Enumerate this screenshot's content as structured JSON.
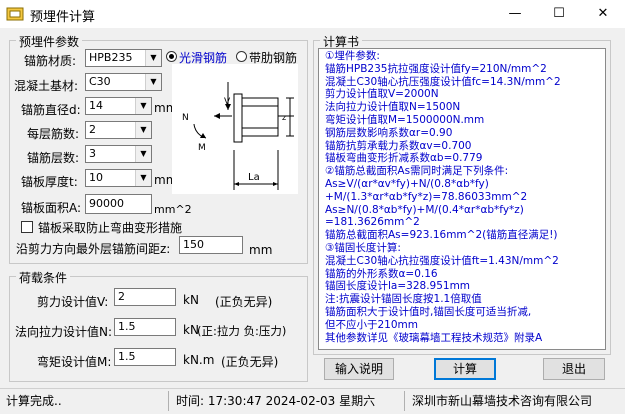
{
  "window": {
    "title": "预埋件计算",
    "minimize": "—",
    "maximize": "☐",
    "close": "✕"
  },
  "params": {
    "group_title": "预埋件参数",
    "rebar_material": {
      "label": "锚筋材质:",
      "value": "HPB235"
    },
    "concrete": {
      "label": "混凝土基材:",
      "value": "C30"
    },
    "rebar_diameter": {
      "label": "锚筋直径d:",
      "value": "14",
      "unit": "mm"
    },
    "bars_per_layer": {
      "label": "每层筋数:",
      "value": "2"
    },
    "layers": {
      "label": "锚筋层数:",
      "value": "3"
    },
    "plate_thickness": {
      "label": "锚板厚度t:",
      "value": "10",
      "unit": "mm"
    },
    "plate_area": {
      "label": "锚板面积A:",
      "value": "90000",
      "unit": "mm^2"
    },
    "radio_smooth": "光滑钢筋",
    "radio_ribbed": "带肋钢筋",
    "checkbox_bending": "锚板采取防止弯曲变形措施",
    "max_spacing": {
      "label": "沿剪力方向最外层锚筋间距z:",
      "value": "150",
      "unit": "mm"
    },
    "diagram": {
      "V": "V",
      "N": "N",
      "M": "M",
      "z": "z",
      "La": "La"
    }
  },
  "loads": {
    "group_title": "荷载条件",
    "shear": {
      "label": "剪力设计值V:",
      "value": "2",
      "unit": "kN",
      "note": "(正负无异)"
    },
    "tension": {
      "label": "法向拉力设计值N:",
      "value": "1.5",
      "unit": "kN",
      "note": "(正:拉力 负:压力)"
    },
    "moment": {
      "label": "弯矩设计值M:",
      "value": "1.5",
      "unit": "kN.m",
      "note": "(正负无异)"
    }
  },
  "report": {
    "group_title": "计算书",
    "lines": [
      "①埋件参数:",
      "  锚筋HPB235抗拉强度设计值fy=210N/mm^2",
      "  混凝土C30轴心抗压强度设计值fc=14.3N/mm^2",
      "  剪力设计值取V=2000N",
      "  法向拉力设计值取N=1500N",
      "  弯矩设计值取M=1500000N.mm",
      "  钢筋层数影响系数αr=0.90",
      "  锚筋抗剪承载力系数αv=0.700",
      "  锚板弯曲变形折减系数αb=0.779",
      "②锚筋总截面积As需同时满足下列条件:",
      "  As≥V/(αr*αv*fy)+N/(0.8*αb*fy)",
      "     +M/(1.3*αr*αb*fy*z)=78.86033mm^2",
      "  As≥N/(0.8*αb*fy)+M/(0.4*αr*αb*fy*z)",
      "     =181.3626mm^2",
      "  锚筋总截面积As=923.16mm^2(锚筋直径满足!)",
      "③锚固长度计算:",
      "  混凝土C30轴心抗拉强度设计值ft=1.43N/mm^2",
      "  锚筋的外形系数α=0.16",
      "  锚固长度设计la=328.951mm",
      "注:抗震设计锚固长度按1.1倍取值",
      "    锚筋面积大于设计值时,锚固长度可适当折减,",
      "    但不应小于210mm",
      "    其他参数详见《玻璃幕墙工程技术规范》附录A"
    ]
  },
  "buttons": {
    "input_help": "输入说明",
    "calculate": "计算",
    "exit": "退出"
  },
  "status": {
    "message": "计算完成..",
    "time": "时间: 17:30:47 2024-02-03 星期六",
    "company": "深圳市新山幕墙技术咨询有限公司"
  }
}
